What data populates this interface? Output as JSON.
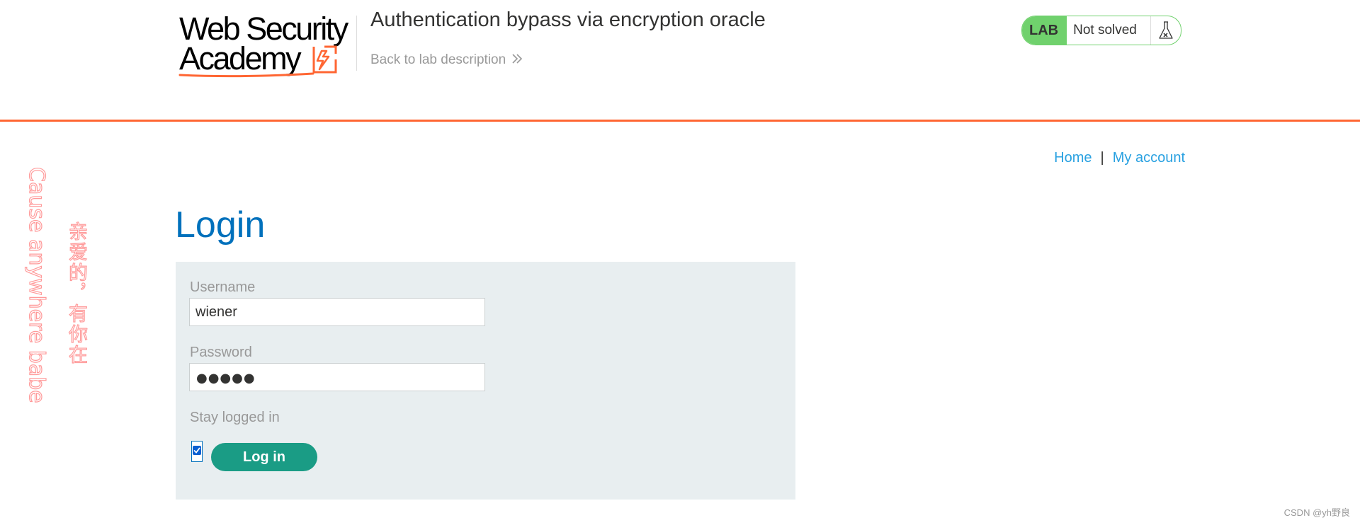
{
  "header": {
    "logo_line1": "Web Security",
    "logo_line2": "Academy",
    "lab_title": "Authentication bypass via encryption oracle",
    "back_link": "Back to lab description",
    "lab_badge": "LAB",
    "lab_status": "Not solved"
  },
  "nav": {
    "home": "Home",
    "separator": "|",
    "my_account": "My account"
  },
  "watermark": {
    "english": "Cause anywhere babe",
    "chinese": "亲爱的，有你在"
  },
  "login": {
    "title": "Login",
    "username_label": "Username",
    "username_value": "wiener",
    "password_label": "Password",
    "password_mask": "●●●●●",
    "stay_logged_in_label": "Stay logged in",
    "stay_logged_in_checked": true,
    "submit_label": "Log in"
  },
  "footer": {
    "credit": "CSDN @yh野良"
  },
  "icons": {
    "back_chevron": "double-chevron-right-icon",
    "lab_flask": "flask-icon",
    "logo_mark": "lightning-bolt-icon"
  },
  "colors": {
    "accent_orange": "#ff6633",
    "brand_blue": "#0071bc",
    "link_blue": "#29a1e1",
    "lab_green": "#70d16d",
    "button_teal": "#1a9c85",
    "panel_bg": "#e8eef0"
  }
}
